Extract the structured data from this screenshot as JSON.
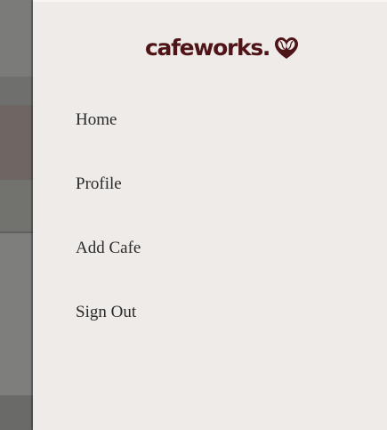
{
  "brand": {
    "name": "cafeworks.",
    "icon": "coffee-bean-heart-icon",
    "color": "#4f1417"
  },
  "nav": {
    "items": [
      {
        "label": "Home"
      },
      {
        "label": "Profile"
      },
      {
        "label": "Add Cafe"
      },
      {
        "label": "Sign Out"
      }
    ]
  },
  "colors": {
    "drawer_background": "#efebe8",
    "backdrop": "#7a7a78",
    "text": "#2a2a2a"
  }
}
